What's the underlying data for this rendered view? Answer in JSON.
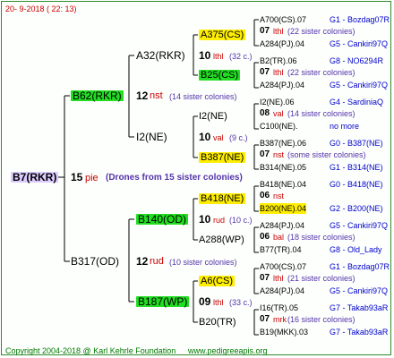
{
  "header": {
    "date": "20-  9-2018 (  22:  13)"
  },
  "footer": {
    "copyright": "Copyright 2004-2018 @ Karl Kehrle Foundation",
    "site": "www.pedigreeapis.org"
  },
  "root": {
    "name": "B7(RKR)",
    "num": "15",
    "mark": "pie",
    "note": "(Drones from 15 sister colonies)"
  },
  "gen1": [
    {
      "name": "B62(RKR)",
      "num": "12",
      "mark": "nst",
      "note": "(14 sister colonies)"
    },
    {
      "name": "B317(OD)",
      "num": "12",
      "mark": "rud",
      "note": "(10 sister colonies)"
    }
  ],
  "gen2": [
    {
      "name": "A32(RKR)",
      "num": "10",
      "mark": "lthl",
      "note": "(32 c.)"
    },
    {
      "name": "I2(NE)",
      "num": "10",
      "mark": "val",
      "note": "(9 c.)"
    },
    {
      "name": "B140(OD)",
      "num": "10",
      "mark": "rud",
      "note": "(10 c.)"
    },
    {
      "name": "B187(WP)",
      "num": "09",
      "mark": "lthl",
      "note": "(33 c.)"
    }
  ],
  "gen3": [
    {
      "name": "A375(CS)",
      "style": "yellow"
    },
    {
      "name": "B25(CS)",
      "style": "green"
    },
    {
      "name": "I2(NE)",
      "style": "plain"
    },
    {
      "name": "B387(NE)",
      "style": "yellow"
    },
    {
      "name": "B418(NE)",
      "style": "yellow"
    },
    {
      "name": "A288(WP)",
      "style": "plain"
    },
    {
      "name": "A6(CS)",
      "style": "yellow"
    },
    {
      "name": "B20(TR)",
      "style": "plain"
    }
  ],
  "gen4": [
    {
      "left": "A700(CS).07",
      "right": "G1 - Bozdag07R",
      "num": "07",
      "mark": "lthl",
      "note": "(22 sister colonies)",
      "left2": "A284(PJ).04",
      "right2": "G5 - Cankiri97Q"
    },
    {
      "left": "B2(TR).06",
      "right": "G8 - NO6294R",
      "num": "07",
      "mark": "lthl",
      "note": "(22 sister colonies)",
      "left2": "A284(PJ).04",
      "right2": "G5 - Cankiri97Q"
    },
    {
      "left": "I2(NE).06",
      "right": "G4 - SardiniaQ",
      "num": "08",
      "mark": "val",
      "note": "(14 sister colonies)",
      "left2": "C100(NE).",
      "right2": "no more"
    },
    {
      "left": "B387(NE).06",
      "right": "G0 - B387(NE)",
      "num": "07",
      "mark": "nst",
      "note": "(some sister colonies)",
      "left2": "B314(NE).05",
      "right2": "G1 - B314(NE)"
    },
    {
      "left": "B418(NE).04",
      "right": "G0 - B418(NE)",
      "num": "06",
      "mark": "nst",
      "note": "",
      "left2": "B200(NE).04",
      "right2": "G2 - B200(NE)"
    },
    {
      "left": "A284(PJ).04",
      "right": "G5 - Cankiri97Q",
      "num": "06",
      "mark": "bal",
      "note": "(18 sister colonies)",
      "left2": "B77(TR).04",
      "right2": "G8 - Old_Lady"
    },
    {
      "left": "A700(CS).07",
      "right": "G1 - Bozdag07R",
      "num": "07",
      "mark": "lthl",
      "note": "(21 sister colonies)",
      "left2": "A284(PJ).04",
      "right2": "G5 - Cankiri97Q"
    },
    {
      "left": "I16(TR).05",
      "right": "G7 - Takab93aR",
      "num": "07",
      "mark": "mrk",
      "note": "(16 sister colonies)",
      "left2": "B19(MKK).03",
      "right2": "G7 - Takab93aR"
    }
  ],
  "colors": {
    "frame": "#2e8b2e",
    "line": "#000000",
    "green": "#22dd22",
    "yellow": "#ffee00",
    "root": "#ddccff"
  }
}
